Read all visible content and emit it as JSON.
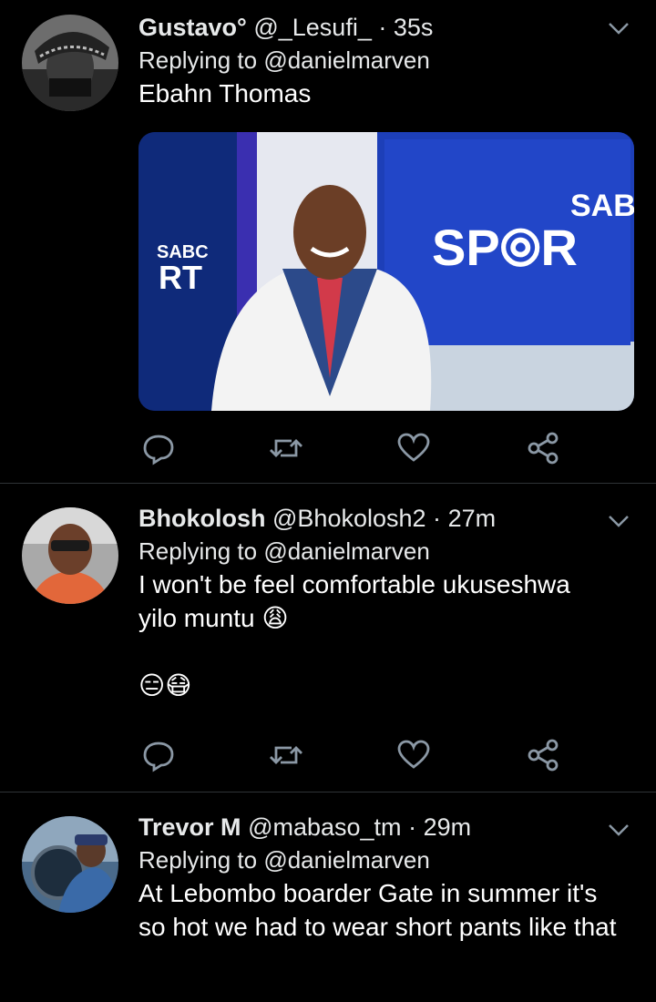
{
  "tweets": [
    {
      "name": "Gustavo°",
      "handle": "@_Lesufi_",
      "sep": "·",
      "time": "35s",
      "reply_prefix": "Replying to",
      "reply_to": "@danielmarven",
      "text": "Ebahn Thomas",
      "media": {
        "sabc_small": "SABC",
        "rt_small": "RT",
        "sabc_big": "SAB",
        "sport_big": "SP⦾R"
      }
    },
    {
      "name": "Bhokolosh",
      "handle": "@Bhokolosh2",
      "sep": "·",
      "time": "27m",
      "reply_prefix": "Replying to",
      "reply_to": "@danielmarven",
      "text": "I won't be feel comfortable ukuseshwa yilo muntu 😩",
      "emoji_line": "😑😷"
    },
    {
      "name": "Trevor M",
      "handle": "@mabaso_tm",
      "sep": "·",
      "time": "29m",
      "reply_prefix": "Replying to",
      "reply_to": "@danielmarven",
      "text": "At Lebombo boarder Gate in summer it's so hot we had to wear short pants like that"
    }
  ],
  "colors": {
    "background": "#000000",
    "divider": "#2f3336",
    "icon": "#8b98a5"
  },
  "icons": [
    "reply-icon",
    "retweet-icon",
    "like-icon",
    "share-icon",
    "chevron-down-icon"
  ]
}
